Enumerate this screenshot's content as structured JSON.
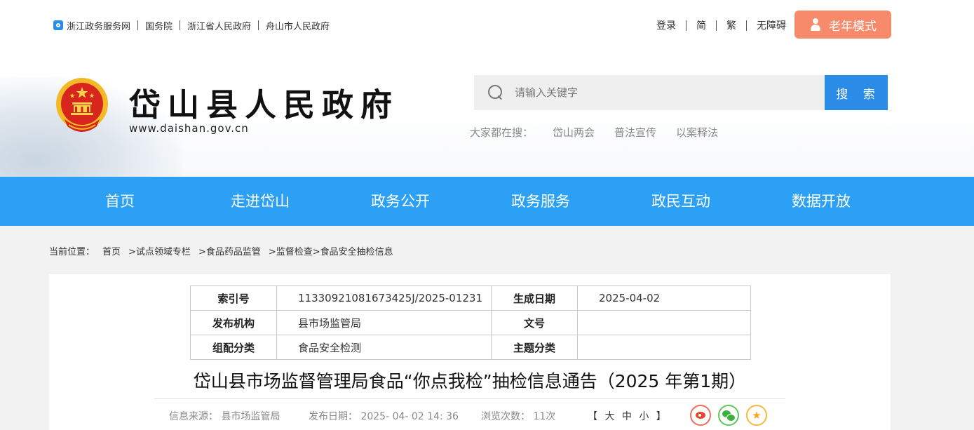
{
  "topbar": {
    "links": [
      "浙江政务服务网",
      "国务院",
      "浙江省人民政府",
      "舟山市人民政府"
    ],
    "right_links": [
      "登录",
      "简",
      "繁",
      "无障碍"
    ],
    "elder_mode": "老年模式"
  },
  "site": {
    "title": "岱山县人民政府",
    "url": "www.daishan.gov.cn"
  },
  "search": {
    "placeholder": "请输入关键字",
    "button": "搜 索",
    "hot_label": "大家都在搜：",
    "hot_items": [
      "岱山两会",
      "普法宣传",
      "以案释法"
    ]
  },
  "nav": {
    "items": [
      "首页",
      "走进岱山",
      "政务公开",
      "政务服务",
      "政民互动",
      "数据开放"
    ]
  },
  "breadcrumb": {
    "label": "当前位置：",
    "items": [
      "首页",
      ">试点领域专栏",
      ">食品药品监管",
      ">监督检查",
      ">食品安全抽检信息"
    ]
  },
  "meta": {
    "index_label": "索引号",
    "index_value": "11330921081673425J/2025-01231",
    "date_label": "生成日期",
    "date_value": "2025-04-02",
    "org_label": "发布机构",
    "org_value": "县市场监管局",
    "docno_label": "文号",
    "docno_value": "",
    "category_label": "组配分类",
    "category_value": "食品安全检测",
    "topic_label": "主题分类",
    "topic_value": ""
  },
  "article": {
    "title": "岱山县市场监督管理局食品“你点我检”抽检信息通告（2025 年第1期）",
    "source": "信息来源：  县市场监管局",
    "publish": "发布日期：  2025- 04- 02 14: 36",
    "views": "浏览次数：  11次",
    "size_control": "【 大 中 小 】"
  },
  "colors": {
    "accent": "#2b8ce8",
    "nav": "#2ba0f5",
    "elder_button": "#f68a6a"
  },
  "icons": [
    "zjzwfw-icon",
    "person-icon",
    "national-emblem",
    "search-icon",
    "weibo-icon",
    "wechat-icon",
    "favorite-icon"
  ]
}
